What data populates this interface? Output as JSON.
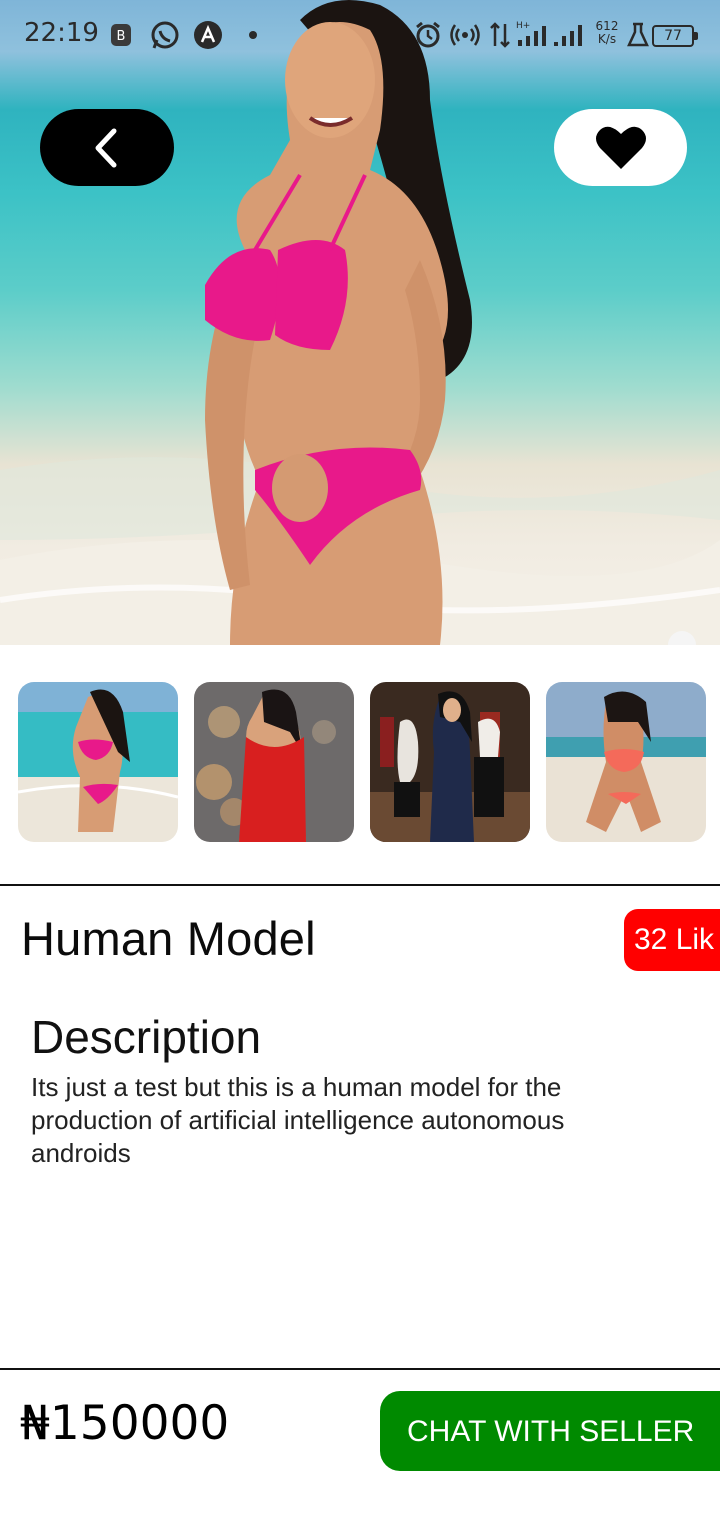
{
  "status_bar": {
    "time": "22:19",
    "network_speed_value": "612",
    "network_speed_unit": "K/s",
    "battery": "77"
  },
  "hero": {
    "back_icon": "chevron-left-icon",
    "favorite_icon": "heart-icon"
  },
  "gallery": {
    "thumbnails": [
      {
        "subject": "woman in pink bikini on beach"
      },
      {
        "subject": "woman in red dress with bokeh lights"
      },
      {
        "subject": "woman in navy dress at art gallery"
      },
      {
        "subject": "woman in coral bikini on sand"
      }
    ]
  },
  "product": {
    "title": "Human Model",
    "likes": "32 Lik"
  },
  "description": {
    "heading": "Description",
    "text": "Its just a test but this is a human model for the production of artificial intelligence autonomous androids"
  },
  "footer": {
    "price": "₦150000",
    "chat_button_label": "CHAT WITH SELLER"
  },
  "colors": {
    "likes_badge": "#ff0000",
    "chat_button": "#008a00",
    "back_button": "#000000",
    "favorite_button": "#ffffff"
  }
}
